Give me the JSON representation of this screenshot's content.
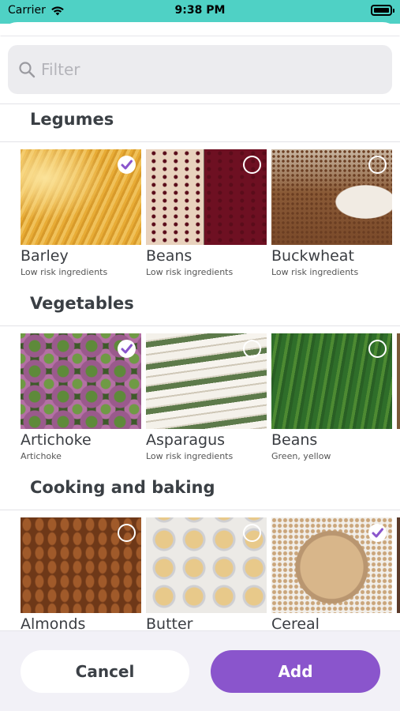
{
  "status_bar": {
    "carrier": "Carrier",
    "time": "9:38 PM"
  },
  "search": {
    "placeholder": "Filter",
    "value": ""
  },
  "sections": [
    {
      "title": "Legumes",
      "items": [
        {
          "name": "Barley",
          "subtitle": "Low risk ingredients",
          "selected": true
        },
        {
          "name": "Beans",
          "subtitle": "Low risk ingredients",
          "selected": false
        },
        {
          "name": "Buckwheat",
          "subtitle": "Low risk ingredients",
          "selected": false
        }
      ]
    },
    {
      "title": "Vegetables",
      "items": [
        {
          "name": "Artichoke",
          "subtitle": "Artichoke",
          "selected": true
        },
        {
          "name": "Asparagus",
          "subtitle": "Low risk ingredients",
          "selected": false
        },
        {
          "name": "Beans",
          "subtitle": "Green, yellow",
          "selected": false
        }
      ]
    },
    {
      "title": "Cooking and baking",
      "items": [
        {
          "name": "Almonds",
          "subtitle": "",
          "selected": false
        },
        {
          "name": "Butter",
          "subtitle": "",
          "selected": false
        },
        {
          "name": "Cereal",
          "subtitle": "",
          "selected": true
        }
      ]
    }
  ],
  "buttons": {
    "cancel": "Cancel",
    "add": "Add"
  },
  "colors": {
    "accent": "#8a55cc",
    "status_bar": "#4fd1c5",
    "check": "#8a55cc"
  },
  "icons": {
    "search": "magnifier-icon",
    "wifi": "wifi-icon",
    "battery": "battery-icon",
    "check": "checkmark-circle-icon"
  }
}
